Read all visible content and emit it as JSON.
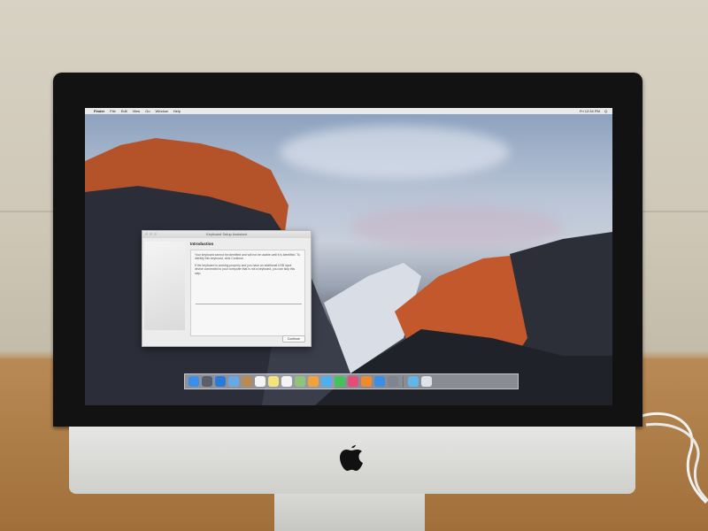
{
  "menubar": {
    "apple_glyph": "",
    "items": [
      "Finder",
      "File",
      "Edit",
      "View",
      "Go",
      "Window",
      "Help"
    ],
    "right_items": [
      "Fri 12:34 PM",
      "Q"
    ]
  },
  "window": {
    "title": "Keyboard Setup Assistant",
    "heading": "Introduction",
    "paragraph_1": "Your keyboard cannot be identified and will not be usable until it is identified. To identify this keyboard, click Continue.",
    "paragraph_2": "If the keyboard is working properly and you have an additional USB input device connected to your computer that is not a keyboard, you can skip this step.",
    "button": "Continue"
  },
  "dock": {
    "icons": [
      {
        "name": "finder-icon",
        "color": "#3b8ee8"
      },
      {
        "name": "launchpad-icon",
        "color": "#5a5f6b"
      },
      {
        "name": "safari-icon",
        "color": "#2a7ad9"
      },
      {
        "name": "mail-icon",
        "color": "#6aa7e6"
      },
      {
        "name": "contacts-icon",
        "color": "#b98b54"
      },
      {
        "name": "calendar-icon",
        "color": "#f4f4f4"
      },
      {
        "name": "notes-icon",
        "color": "#f5e27a"
      },
      {
        "name": "reminders-icon",
        "color": "#f4f4f4"
      },
      {
        "name": "maps-icon",
        "color": "#8fc478"
      },
      {
        "name": "photos-icon",
        "color": "#f1a23c"
      },
      {
        "name": "messages-icon",
        "color": "#4fb0f0"
      },
      {
        "name": "facetime-icon",
        "color": "#3ec45a"
      },
      {
        "name": "itunes-icon",
        "color": "#e84a79"
      },
      {
        "name": "ibooks-icon",
        "color": "#ef8b2c"
      },
      {
        "name": "app-store-icon",
        "color": "#3a8ee6"
      },
      {
        "name": "system-preferences-icon",
        "color": "#7f8590"
      }
    ],
    "right_icons": [
      {
        "name": "downloads-folder-icon",
        "color": "#62b5ea"
      },
      {
        "name": "trash-icon",
        "color": "#dfe3e8"
      }
    ]
  },
  "colors": {
    "bezel": "#121212",
    "chin": "#dcdcda",
    "desk": "#a8773f",
    "wall": "#d3ccbd"
  }
}
